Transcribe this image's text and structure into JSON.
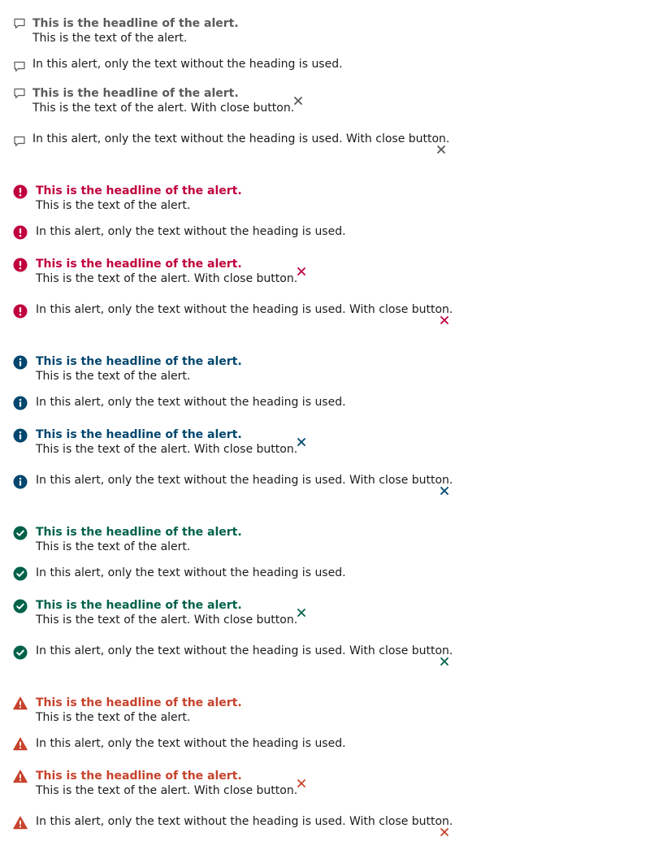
{
  "colors": {
    "default": "#5a5a5a",
    "error": "#c0003c",
    "info": "#00466e",
    "success": "#00614a",
    "warning": "#c7422b",
    "text": "#1b1b1b"
  },
  "groups": [
    {
      "variant": "default",
      "icon": "speech-bubble-icon",
      "alerts": [
        {
          "headline": "This is the headline of the alert.",
          "text": "This is the text of the alert."
        },
        {
          "text": "In this alert, only the text without the heading is used."
        },
        {
          "headline": "This is the headline of the alert.",
          "text": "This is the text of the alert. With close button."
        },
        {
          "text": "In this alert, only the text without the heading is used. With close button."
        }
      ]
    },
    {
      "variant": "error",
      "icon": "exclamation-circle-icon",
      "alerts": [
        {
          "headline": "This is the headline of the alert.",
          "text": "This is the text of the alert."
        },
        {
          "text": "In this alert, only the text without the heading is used."
        },
        {
          "headline": "This is the headline of the alert.",
          "text": "This is the text of the alert. With close button."
        },
        {
          "text": "In this alert, only the text without the heading is used. With close button."
        }
      ]
    },
    {
      "variant": "info",
      "icon": "info-circle-icon",
      "alerts": [
        {
          "headline": "This is the headline of the alert.",
          "text": "This is the text of the alert."
        },
        {
          "text": "In this alert, only the text without the heading is used."
        },
        {
          "headline": "This is the headline of the alert.",
          "text": "This is the text of the alert. With close button."
        },
        {
          "text": "In this alert, only the text without the heading is used. With close button."
        }
      ]
    },
    {
      "variant": "success",
      "icon": "checkmark-circle-icon",
      "alerts": [
        {
          "headline": "This is the headline of the alert.",
          "text": "This is the text of the alert."
        },
        {
          "text": "In this alert, only the text without the heading is used."
        },
        {
          "headline": "This is the headline of the alert.",
          "text": "This is the text of the alert. With close button."
        },
        {
          "text": "In this alert, only the text without the heading is used. With close button."
        }
      ]
    },
    {
      "variant": "warning",
      "icon": "warning-triangle-icon",
      "alerts": [
        {
          "headline": "This is the headline of the alert.",
          "text": "This is the text of the alert."
        },
        {
          "text": "In this alert, only the text without the heading is used."
        },
        {
          "headline": "This is the headline of the alert.",
          "text": "This is the text of the alert. With close button."
        },
        {
          "text": "In this alert, only the text without the heading is used. With close button."
        }
      ]
    }
  ]
}
